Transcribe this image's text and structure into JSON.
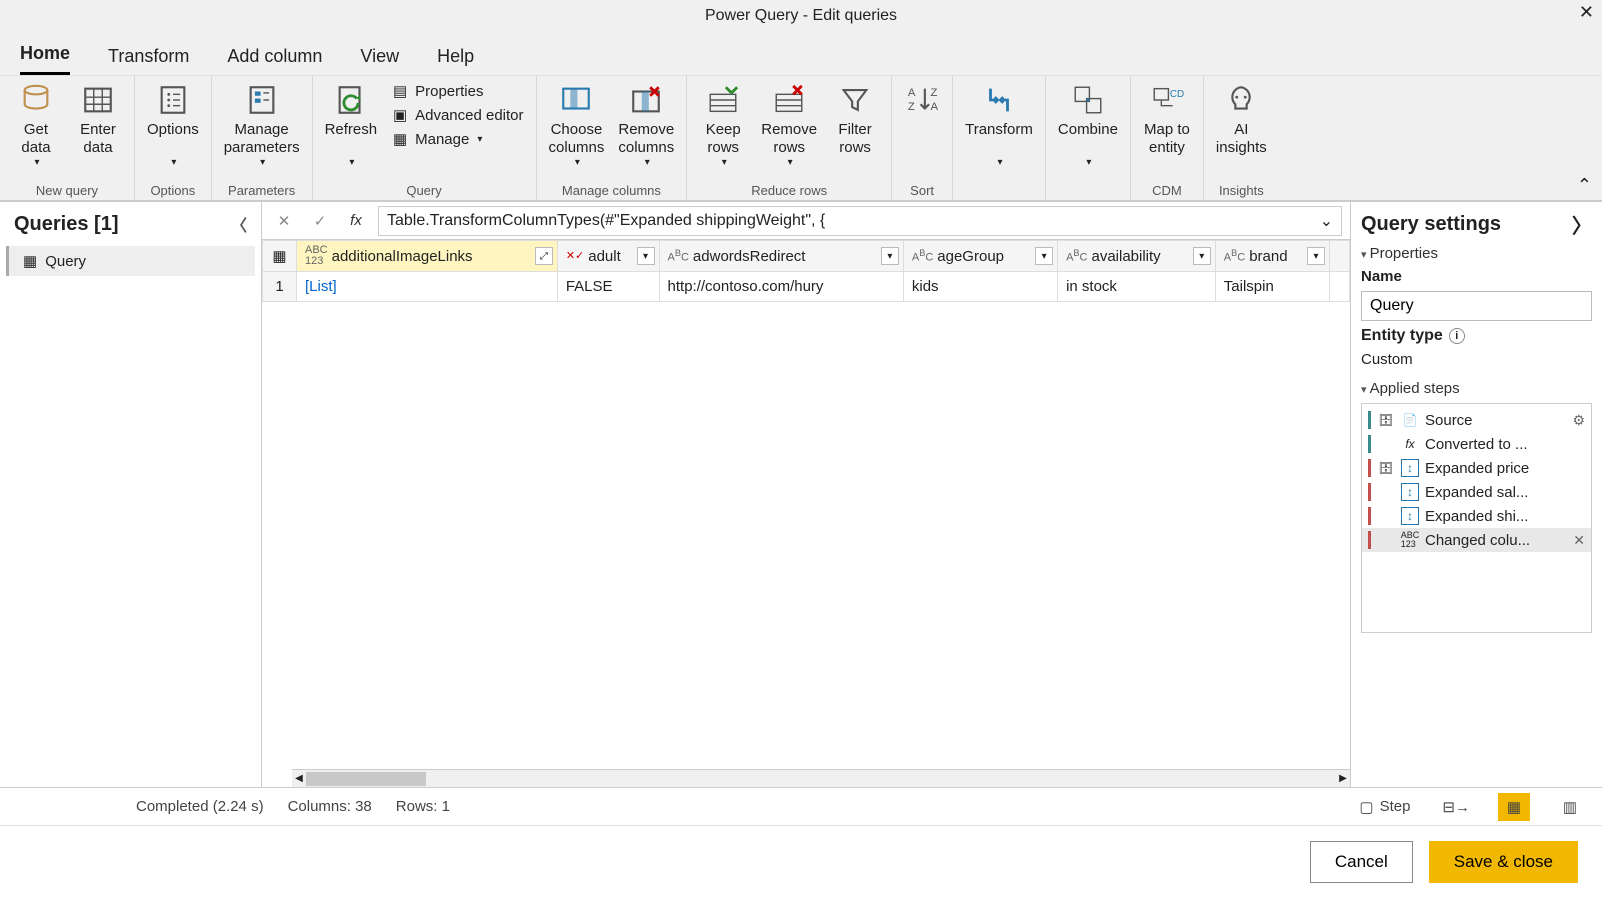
{
  "window": {
    "title": "Power Query - Edit queries"
  },
  "tabs": {
    "items": [
      "Home",
      "Transform",
      "Add column",
      "View",
      "Help"
    ],
    "active": "Home"
  },
  "ribbon": {
    "groups": {
      "new_query": {
        "label": "New query",
        "get_data": "Get\ndata",
        "enter_data": "Enter\ndata"
      },
      "options": {
        "label": "Options",
        "options": "Options"
      },
      "parameters": {
        "label": "Parameters",
        "manage": "Manage\nparameters"
      },
      "query": {
        "label": "Query",
        "refresh": "Refresh",
        "properties": "Properties",
        "advanced": "Advanced editor",
        "manage": "Manage"
      },
      "manage_cols": {
        "label": "Manage columns",
        "choose": "Choose\ncolumns",
        "remove": "Remove\ncolumns"
      },
      "reduce": {
        "label": "Reduce rows",
        "keep": "Keep\nrows",
        "remove": "Remove\nrows",
        "filter": "Filter\nrows"
      },
      "sort": {
        "label": "Sort"
      },
      "transform": {
        "label": "Transform"
      },
      "combine": {
        "label": "Combine"
      },
      "cdm": {
        "label": "CDM",
        "map": "Map to\nentity"
      },
      "insights": {
        "label": "Insights",
        "ai": "AI\ninsights"
      }
    }
  },
  "queries_panel": {
    "title": "Queries [1]",
    "item": "Query"
  },
  "formula": "Table.TransformColumnTypes(#\"Expanded shippingWeight\", {",
  "grid": {
    "columns": [
      {
        "name": "additionalImageLinks",
        "type": "ABC123",
        "selected": true,
        "expand": true
      },
      {
        "name": "adult",
        "type": "bool"
      },
      {
        "name": "adwordsRedirect",
        "type": "text"
      },
      {
        "name": "ageGroup",
        "type": "text"
      },
      {
        "name": "availability",
        "type": "text"
      },
      {
        "name": "brand",
        "type": "text"
      }
    ],
    "rows": [
      {
        "n": "1",
        "cells": [
          "[List]",
          "FALSE",
          "http://contoso.com/hury",
          "kids",
          "in stock",
          "Tailspin"
        ]
      }
    ]
  },
  "settings": {
    "title": "Query settings",
    "properties_label": "Properties",
    "name_label": "Name",
    "name_value": "Query",
    "entity_label": "Entity type",
    "entity_value": "Custom",
    "applied_label": "Applied steps",
    "steps": [
      {
        "label": "Source",
        "icon": "json",
        "gear": true,
        "bar": "teal"
      },
      {
        "label": "Converted to ...",
        "icon": "fx",
        "bar": "teal"
      },
      {
        "label": "Expanded price",
        "icon": "expand",
        "bar": "red"
      },
      {
        "label": "Expanded sal...",
        "icon": "expand",
        "bar": "red"
      },
      {
        "label": "Expanded shi...",
        "icon": "expand",
        "bar": "red"
      },
      {
        "label": "Changed colu...",
        "icon": "abc",
        "selected": true,
        "del": true,
        "bar": "red"
      }
    ]
  },
  "status": {
    "completed": "Completed (2.24 s)",
    "columns": "Columns: 38",
    "rows": "Rows: 1",
    "step": "Step"
  },
  "footer": {
    "cancel": "Cancel",
    "save": "Save & close"
  }
}
